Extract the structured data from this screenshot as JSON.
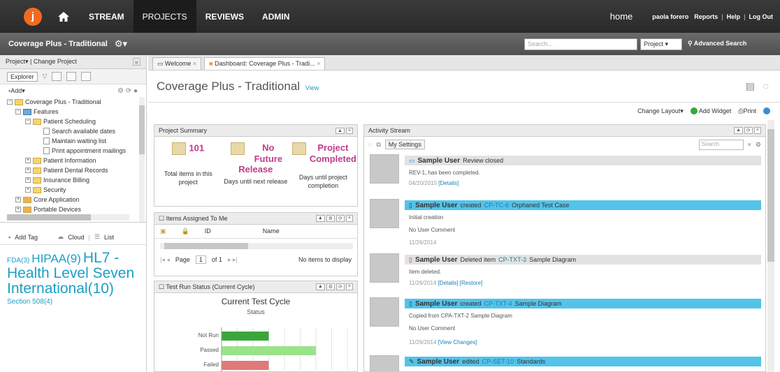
{
  "topnav": {
    "logo": "j",
    "items": [
      "STREAM",
      "PROJECTS",
      "REVIEWS",
      "ADMIN"
    ],
    "home": "home",
    "user": "paola forero",
    "reports": "Reports",
    "help": "Help",
    "logout": "Log Out"
  },
  "subbar": {
    "project": "Coverage Plus - Traditional",
    "search_placeholder": "Search...",
    "scope": "Project",
    "advanced": "Advanced Search"
  },
  "left": {
    "header": "Project▾ | Change Project",
    "explorer_tab": "Explorer",
    "add": "Add▾",
    "tree": [
      "Coverage Plus - Traditional",
      "Features",
      "Patient Scheduling",
      "Search available dates",
      "Maintain waiting list",
      "Print appointment mailings",
      "Patient Information",
      "Patient Dental Records",
      "Insurance Billing",
      "Security",
      "Core Application",
      "Portable Devices"
    ],
    "add_tag": "Add Tag",
    "cloud": "Cloud",
    "list": "List",
    "tags": {
      "fda": "FDA(3)",
      "hipaa": "HIPAA(9)",
      "hl7": "HL7 - Health Level Seven International(10)",
      "section": "Section 508(4)"
    }
  },
  "tabs": [
    "Welcome",
    "Dashboard: Coverage Plus - Tradi..."
  ],
  "page": {
    "title": "Coverage Plus - Traditional",
    "view": "View"
  },
  "layoutbar": {
    "change_layout": "Change Layout▾",
    "add_widget": "Add Widget",
    "print": "Print"
  },
  "summary": {
    "title": "Project Summary",
    "items_value": "101",
    "items_label": "Total items in this project",
    "release_value": "No Future Release",
    "release_label": "Days until next release",
    "completion_value": "Project Completed",
    "completion_label": "Days until project completion"
  },
  "assigned": {
    "title": "Items Assigned To Me",
    "col_id": "ID",
    "col_name": "Name",
    "page_label": "Page",
    "page_value": "1",
    "of": "of 1",
    "empty": "No items to display"
  },
  "testrun": {
    "title": "Test Run Status (Current Cycle)",
    "chart_title": "Current Test Cycle",
    "chart_subtitle": "Status"
  },
  "chart_data": {
    "type": "bar",
    "title": "Current Test Cycle",
    "subtitle": "Status",
    "categories": [
      "Not Run",
      "Passed",
      "Failed"
    ],
    "values": [
      3,
      6,
      3
    ],
    "colors": [
      "#3aa63a",
      "#9be38a",
      "#e07a7a"
    ]
  },
  "activity": {
    "title": "Activity Stream",
    "settings": "My Settings",
    "search_placeholder": "Search",
    "items": [
      {
        "user": "Sample User",
        "action": "Review closed",
        "line1": "REV-1, has been completed.",
        "date": "04/20/2015",
        "links": "[Details]"
      },
      {
        "user": "Sample User",
        "action": "created",
        "id": "CP-TC-6",
        "name": "Orphaned Test Case",
        "line1": "Initial creation",
        "line2": "No User Comment",
        "date": "11/26/2014"
      },
      {
        "user": "Sample User",
        "action": "Deleted item",
        "id": "CP-TXT-3",
        "name": "Sample Diagram",
        "line1": "Item deleted.",
        "date": "11/26/2014",
        "links": "[Details] [Restore]"
      },
      {
        "user": "Sample User",
        "action": "created",
        "id": "CP-TXT-4",
        "name": "Sample Diagram",
        "line1": "Copied from CPA-TXT-2 Sample Diagram",
        "line2": "No User Comment",
        "date": "11/26/2014",
        "links": "[View Changes]"
      },
      {
        "user": "Sample User",
        "action": "edited",
        "id": "CP-SET-10",
        "name": "Standards"
      }
    ]
  }
}
